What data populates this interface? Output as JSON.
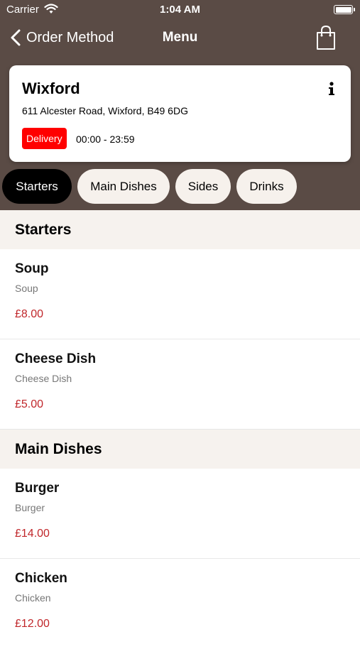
{
  "status_bar": {
    "carrier": "Carrier",
    "time": "1:04 AM"
  },
  "nav": {
    "back_label": "Order Method",
    "title": "Menu"
  },
  "store": {
    "name": "Wixford",
    "address": "611 Alcester Road, Wixford, B49 6DG",
    "badge": "Delivery",
    "hours": "00:00 - 23:59"
  },
  "tabs": [
    {
      "label": "Starters",
      "active": true
    },
    {
      "label": "Main Dishes",
      "active": false
    },
    {
      "label": "Sides",
      "active": false
    },
    {
      "label": "Drinks",
      "active": false
    }
  ],
  "sections": [
    {
      "title": "Starters",
      "items": [
        {
          "name": "Soup",
          "description": "Soup",
          "price": "£8.00"
        },
        {
          "name": "Cheese Dish",
          "description": "Cheese Dish",
          "price": "£5.00"
        }
      ]
    },
    {
      "title": "Main Dishes",
      "items": [
        {
          "name": "Burger",
          "description": "Burger",
          "price": "£14.00"
        },
        {
          "name": "Chicken",
          "description": "Chicken",
          "price": "£12.00"
        }
      ]
    }
  ],
  "colors": {
    "header_bg": "#5a4b45",
    "badge_bg": "#ff0000",
    "price": "#c0262a",
    "tab_active_bg": "#000000",
    "tab_bg": "#f6f1ec"
  }
}
